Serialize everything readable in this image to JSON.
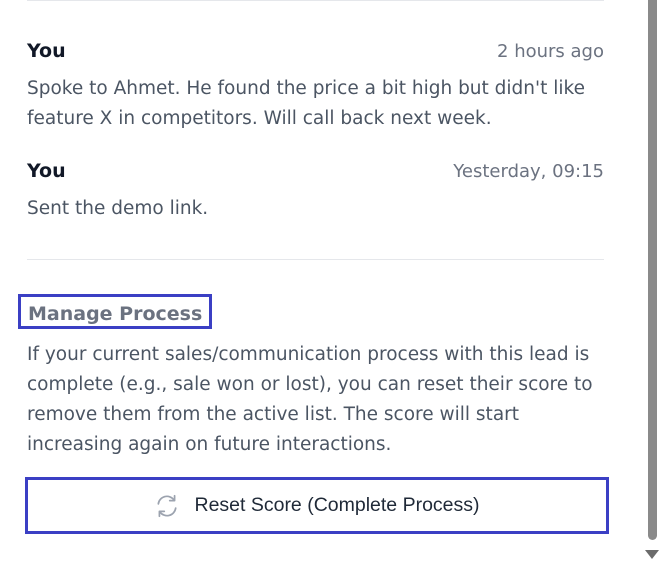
{
  "notes": [
    {
      "author": "You",
      "time": "2 hours ago",
      "text": "Spoke to Ahmet. He found the price a bit high but didn't like feature X in competitors. Will call back next week."
    },
    {
      "author": "You",
      "time": "Yesterday, 09:15",
      "text": "Sent the demo link."
    }
  ],
  "process": {
    "title": "Manage Process",
    "description": "If your current sales/communication process with this lead is complete (e.g., sale won or lost), you can reset their score to remove them from the active list. The score will start increasing again on future interactions.",
    "reset_label": "Reset Score (Complete Process)",
    "reset_icon": "refresh-icon"
  },
  "colors": {
    "highlight_border": "#3b3fc4",
    "muted_text": "#6b7280",
    "body_text": "#4b5563"
  }
}
